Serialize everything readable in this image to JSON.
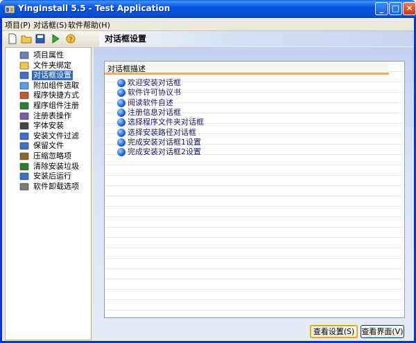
{
  "window": {
    "title": "YingInstall 5.5 - Test Application"
  },
  "menu": [
    "项目(P)",
    "对话框(S)",
    "软件帮助(H)"
  ],
  "toolbar": {
    "icons": [
      "new-file-icon",
      "open-folder-icon",
      "save-icon",
      "run-icon",
      "help-icon"
    ]
  },
  "header": {
    "title": "对话框设置"
  },
  "sidebar": {
    "items": [
      {
        "label": "项目属性",
        "icon": "properties-icon"
      },
      {
        "label": "文件夹绑定",
        "icon": "folder-icon"
      },
      {
        "label": "对话框设置",
        "icon": "dialog-icon",
        "selected": true
      },
      {
        "label": "附加组件选取",
        "icon": "component-icon"
      },
      {
        "label": "程序快捷方式",
        "icon": "shortcut-icon"
      },
      {
        "label": "程序组件注册",
        "icon": "register-icon"
      },
      {
        "label": "注册表操作",
        "icon": "registry-icon"
      },
      {
        "label": "字体安装",
        "icon": "font-icon"
      },
      {
        "label": "安装文件过滤",
        "icon": "filter-icon"
      },
      {
        "label": "保留文件",
        "icon": "keep-file-icon"
      },
      {
        "label": "压缩忽略项",
        "icon": "compress-icon"
      },
      {
        "label": "清除安装垃圾",
        "icon": "clean-icon"
      },
      {
        "label": "安装后运行",
        "icon": "run-after-icon"
      },
      {
        "label": "软件卸载选项",
        "icon": "uninstall-icon"
      }
    ]
  },
  "list": {
    "header": "对话框描述",
    "rows": [
      "欢迎安装对话框",
      "软件许可协议书",
      "阅读软件自述",
      "注册信息对话框",
      "选择程序文件夹对话框",
      "选择安装路径对话框",
      "完成安装对话框1设置",
      "完成安装对话框2设置"
    ]
  },
  "buttons": {
    "view_settings": "查看设置(S)",
    "view_ui": "查看界面(V)"
  },
  "colors": {
    "titlebar": "#0855dd",
    "selection": "#316ac5",
    "header_underline": "#f4b13b"
  }
}
